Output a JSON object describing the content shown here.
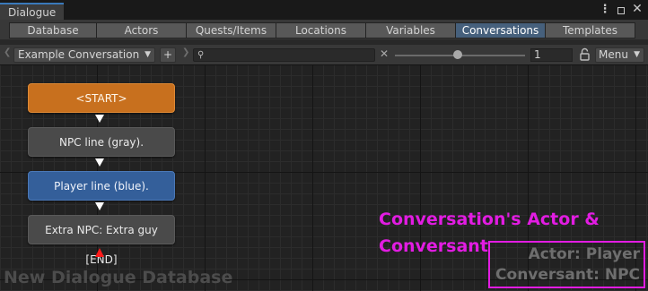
{
  "window": {
    "title": "Dialogue",
    "icons": [
      "more-options-icon",
      "maximize-icon",
      "close-icon"
    ]
  },
  "tabs": [
    {
      "label": "Database",
      "active": false
    },
    {
      "label": "Actors",
      "active": false
    },
    {
      "label": "Quests/Items",
      "active": false
    },
    {
      "label": "Locations",
      "active": false
    },
    {
      "label": "Variables",
      "active": false
    },
    {
      "label": "Conversations",
      "active": true
    },
    {
      "label": "Templates",
      "active": false
    }
  ],
  "toolbar": {
    "conversation": "Example Conversation",
    "add_label": "+",
    "search_value": "",
    "zoom_value": "1",
    "menu_label": "Menu"
  },
  "nodes": [
    {
      "label": "<START>",
      "kind": "start"
    },
    {
      "label": "NPC line (gray).",
      "kind": "npc"
    },
    {
      "label": "Player line (blue).",
      "kind": "player"
    },
    {
      "label": "Extra NPC: Extra guy [END]",
      "kind": "npc"
    }
  ],
  "canvas": {
    "database_name": "New Dialogue Database",
    "annotation_line1": "Conversation's Actor &",
    "annotation_line2": "Conversant",
    "actor": "Actor: Player",
    "conversant": "Conversant: NPC"
  },
  "colors": {
    "accent_tab": "#46607c",
    "start_node": "#c8701e",
    "npc_node": "#4a4a4a",
    "player_node": "#345f9a",
    "annotation": "#e21ce2",
    "end_marker": "#ff1a1a"
  }
}
